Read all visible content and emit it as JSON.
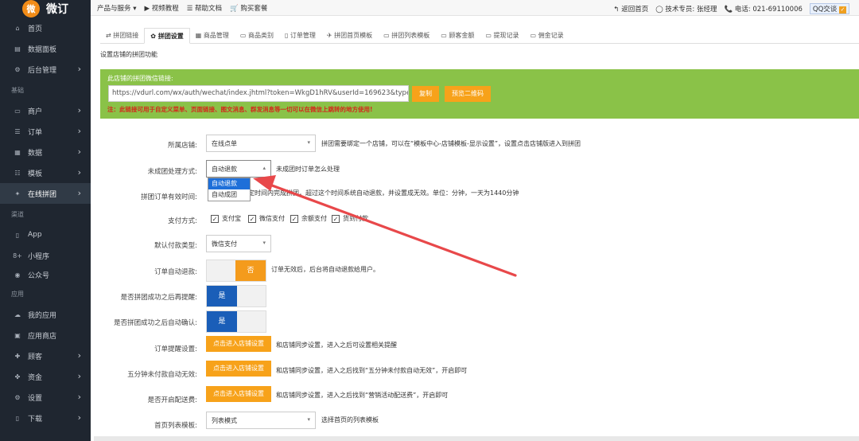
{
  "brand": {
    "logo_char": "微",
    "name": "微订"
  },
  "sidebar": {
    "items": [
      {
        "label": "首页",
        "icon": "⌂",
        "chev": ""
      },
      {
        "label": "数据面板",
        "icon": "▤",
        "chev": ""
      },
      {
        "label": "后台管理",
        "icon": "⚙",
        "chev": "›"
      },
      {
        "label": "商户",
        "icon": "▭",
        "chev": "›"
      },
      {
        "label": "订单",
        "icon": "☰",
        "chev": "›"
      },
      {
        "label": "数据",
        "icon": "▦",
        "chev": "›"
      },
      {
        "label": "模板",
        "icon": "☷",
        "chev": "›"
      },
      {
        "label": "在线拼团",
        "icon": "✦",
        "chev": "›"
      },
      {
        "label": "App",
        "icon": "▯",
        "chev": ""
      },
      {
        "label": "小程序",
        "icon": "8+",
        "chev": ""
      },
      {
        "label": "公众号",
        "icon": "◉",
        "chev": ""
      },
      {
        "label": "我的应用",
        "icon": "☁",
        "chev": ""
      },
      {
        "label": "应用商店",
        "icon": "▣",
        "chev": ""
      },
      {
        "label": "顾客",
        "icon": "✚",
        "chev": "›"
      },
      {
        "label": "资金",
        "icon": "✤",
        "chev": "›"
      },
      {
        "label": "设置",
        "icon": "⚙",
        "chev": "›"
      },
      {
        "label": "下载",
        "icon": "▯",
        "chev": "›"
      }
    ],
    "sections": [
      "基础",
      "渠道",
      "应用"
    ]
  },
  "topbar": {
    "left": [
      "产品与服务 ▾",
      "▶ 视频教程",
      "☰ 帮助文档",
      "🛒 购买套餐"
    ],
    "right": [
      "↰ 返回首页",
      "◯ 技术专员: 张经理",
      "📞 电话: 021-69110006"
    ],
    "qq": "QQ交谈"
  },
  "tabs": [
    "拼团链接",
    "拼团设置",
    "商品管理",
    "商品类别",
    "订单管理",
    "拼团首页模板",
    "拼团列表模板",
    "顾客金额",
    "提现记录",
    "佣金记录"
  ],
  "subtitle": "设置店铺的拼团功能",
  "link": {
    "title": "此店铺的拼团微信链接:",
    "url": "https://vdurl.com/wx/auth/wechat/index.jhtml?token=WkgD1hRV&userId=169623&type",
    "copy": "复制",
    "qrcode": "预览二维码",
    "note": "注：此链接可用于自定义菜单、页面链接、图文消息、群发消息等一切可以在微信上跳转的地方使用!"
  },
  "form": {
    "store_label": "所属店铺:",
    "store_value": "在线点单",
    "store_desc": "拼团需要绑定一个店铺，可以在“模板中心-店铺模板-显示设置”，设置点击店铺版进入到拼团",
    "fail_label": "未成团处理方式:",
    "fail_value": "自动退款",
    "fail_desc": "未成团时订单怎么处理",
    "fail_options": [
      "自动退款",
      "自动成团"
    ],
    "valid_label": "拼团订单有效时间:",
    "valid_desc": "团长必须在规定时间内完成拼团，超过这个时间系统自动退款，并设置成无效。单位：分钟，一天为1440分钟",
    "pay_label": "支付方式:",
    "pay_options": [
      "支付宝",
      "微信支付",
      "余额支付",
      "货到付款"
    ],
    "default_pay_label": "默认付款类型:",
    "default_pay_value": "微信支付",
    "auto_refund_label": "订单自动退款:",
    "auto_refund_state": "否",
    "auto_refund_desc": "订单无效后，后台将自动退款给用户。",
    "remind_label": "是否拼团成功之后再提醒:",
    "remind_state": "是",
    "confirm_label": "是否拼团成功之后自动确认:",
    "confirm_state": "是",
    "order_remind_label": "订单提醒设置:",
    "order_remind_btn": "点击进入店铺设置",
    "order_remind_desc": "和店铺同步设置，进入之后可设置相关提醒",
    "five_min_label": "五分钟未付款自动无效:",
    "five_min_btn": "点击进入店铺设置",
    "five_min_desc": "和店铺同步设置，进入之后找到“五分钟未付款自动无效”，开启即可",
    "delivery_label": "是否开启配送费:",
    "delivery_btn": "点击进入店铺设置",
    "delivery_desc": "和店铺同步设置，进入之后找到“营销活动配送费”，开启即可",
    "list_tpl_label": "首页列表模板:",
    "list_tpl_value": "列表模式",
    "list_tpl_desc": "选择首页的列表模板"
  },
  "colors": {
    "sidebar": "#1f2630",
    "accent": "#f7a21a",
    "green": "#8ac248",
    "blue": "#1a5eb8",
    "arrow": "#e8484a"
  }
}
